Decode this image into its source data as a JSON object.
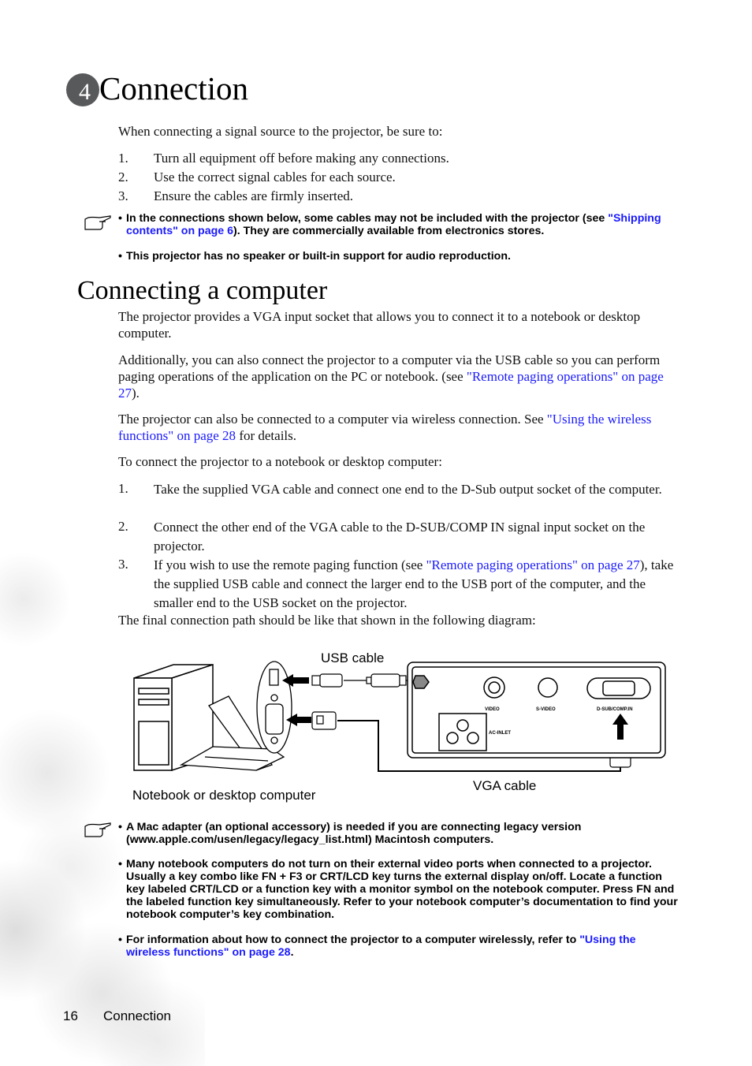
{
  "chapter": {
    "number": "4",
    "title": "Connection"
  },
  "intro": "When connecting a signal source to the projector, be sure to:",
  "intro_steps": [
    {
      "num": "1.",
      "text": "Turn all equipment off before making any connections."
    },
    {
      "num": "2.",
      "text": "Use the correct signal cables for each source."
    },
    {
      "num": "3.",
      "text": "Ensure the cables are firmly inserted."
    }
  ],
  "note1": {
    "icon": "pointing-hand-icon",
    "bullets": [
      {
        "pre": "In the connections shown below, some cables may not be included with the projector (see ",
        "link": "\"Shipping contents\" on page 6",
        "post": "). They are commercially available from electronics stores."
      },
      {
        "pre": "This projector has no speaker or built-in support for audio reproduction.",
        "link": "",
        "post": ""
      }
    ]
  },
  "section": {
    "title": "Connecting a computer",
    "para1": "The projector provides a VGA input socket that allows you to connect it to a notebook or desktop computer.",
    "para2_pre": "Additionally, you can also connect the projector to a computer via the USB cable so you can perform paging operations of the application on the PC or notebook. (see ",
    "para2_link": "\"Remote paging operations\" on page 27",
    "para2_post": ").",
    "para3_pre": "The projector can also be connected to a computer via wireless connection. See ",
    "para3_link": "\"Using the wireless functions\" on page 28",
    "para3_post": " for details.",
    "para4": "To connect the projector to a notebook or desktop computer:",
    "steps": [
      {
        "num": "1.",
        "pre": "Take the supplied VGA cable and connect one end to the D-Sub output socket of the computer.",
        "link": "",
        "post": ""
      },
      {
        "num": "2.",
        "pre": "Connect the other end of the VGA cable to the D-SUB/COMP IN signal input socket on the projector.",
        "link": "",
        "post": ""
      },
      {
        "num": "3.",
        "pre": "If you wish to use the remote paging function (see ",
        "link": "\"Remote paging operations\" on page 27",
        "post": "), take the supplied USB cable and connect the larger end to the USB port of the computer, and the smaller end to the USB socket on the projector."
      }
    ],
    "diagram_intro": "The final connection path should be like that shown in the following diagram:"
  },
  "diagram": {
    "usb_cable_label": "USB cable",
    "vga_cable_label": "VGA cable",
    "computer_label": "Notebook or desktop computer",
    "port_labels": {
      "video": "VIDEO",
      "svideo": "S-VIDEO",
      "dsub": "D-SUB/COMP.IN",
      "ac": "AC-INLET"
    }
  },
  "note2": {
    "icon": "pointing-hand-icon",
    "bullets": [
      {
        "pre": "A Mac adapter (an optional accessory) is needed if you are connecting legacy version (www.apple.com/usen/legacy/legacy_list.html) Macintosh computers.",
        "link": "",
        "post": ""
      },
      {
        "pre": "Many notebook computers do not turn on their external video ports when connected to a projector. Usually a key combo like FN + F3 or CRT/LCD key turns the external display on/off. Locate a function key labeled CRT/LCD or a function key with a monitor symbol on the notebook computer. Press FN and the labeled function key simultaneously. Refer to your notebook computer’s documentation to find your notebook computer’s key combination.",
        "link": "",
        "post": ""
      },
      {
        "pre": "For information about how to connect the projector to a computer wirelessly, refer to ",
        "link": "\"Using the wireless functions\" on page 28",
        "post": "."
      }
    ]
  },
  "footer": {
    "page_number": "16",
    "section": "Connection"
  },
  "colors": {
    "link": "#1a1aff",
    "badge": "#58595b"
  }
}
